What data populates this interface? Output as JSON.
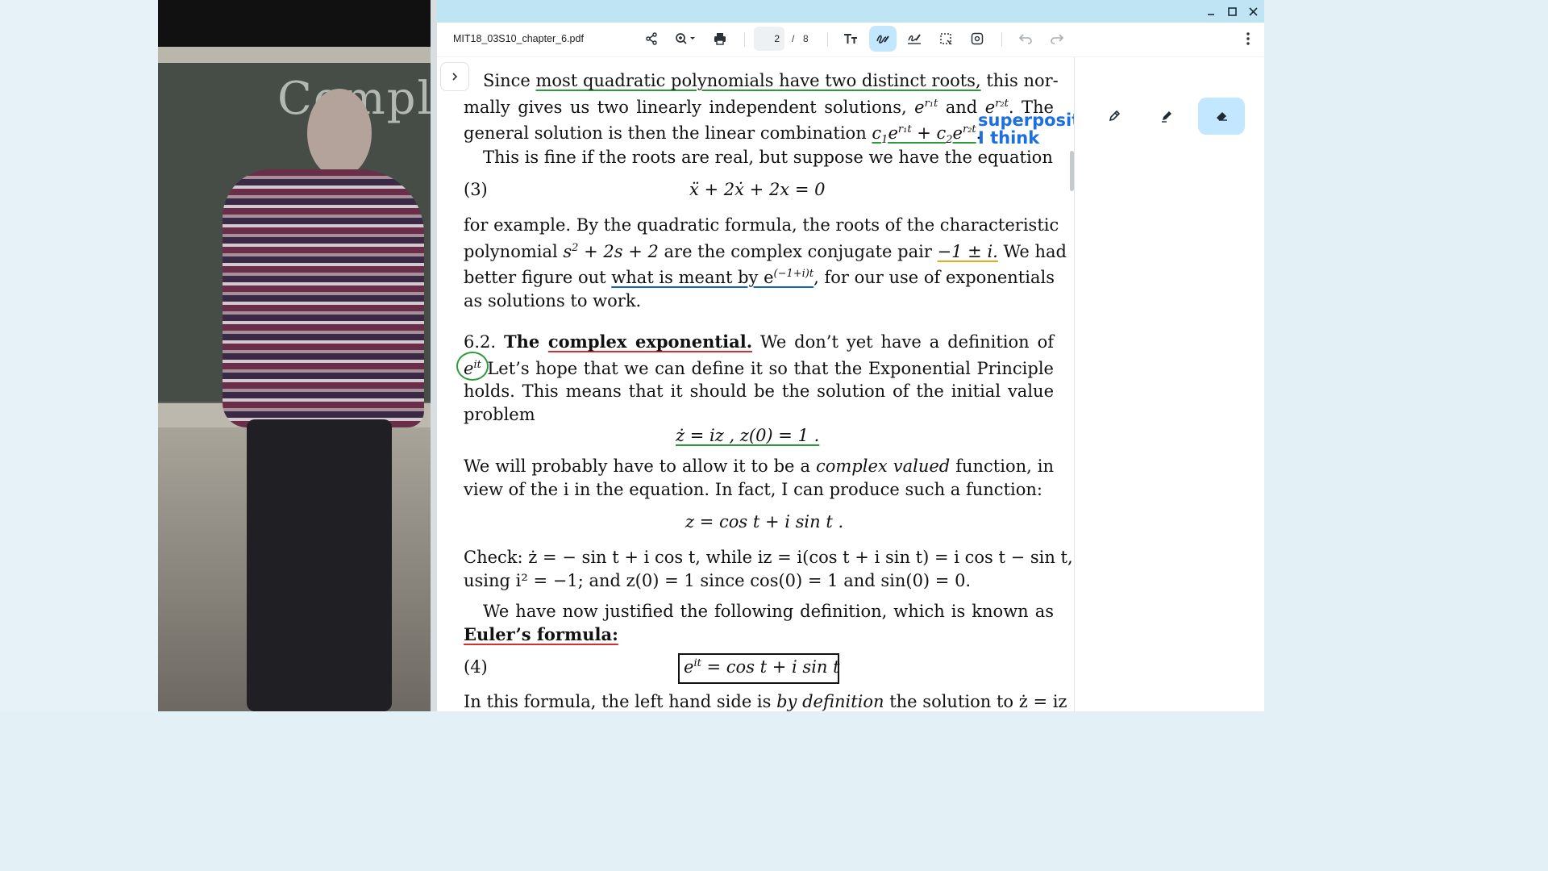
{
  "window": {
    "filename": "MIT18_03S10_chapter_6.pdf",
    "current_page": "2",
    "page_separator": "/",
    "total_pages": "8"
  },
  "video": {
    "board_text": "Complex"
  },
  "document": {
    "p1_lines": [
      "Since most quadratic polynomials have two distinct roots, this nor-",
      "mally gives us two linearly independent solutions, e^{r1t} and e^{r2t}. The",
      "general solution is then the linear combination c1e^{r1t} + c2e^{r2t}."
    ],
    "p1_l1_a": "Since ",
    "p1_l1_ul": "most quadratic polynomials have two distinct roots,",
    "p1_l1_b": " this nor-",
    "p1_l2_a": "mally gives us two linearly independent solutions, ",
    "p1_l2_b": " and ",
    "p1_l2_c": ".  The",
    "p1_l3_a": "general solution is then the linear combination ",
    "note": [
      "superposition",
      "I think"
    ],
    "p2": "This is fine if the roots are real, but suppose we have the equation",
    "eq3_num": "(3)",
    "eq3": "ẍ + 2ẋ + 2x = 0",
    "p3_l1": "for example.  By the quadratic formula, the roots of the characteristic",
    "p3_l2_a": "polynomial ",
    "p3_l2_b": " are the complex conjugate pair ",
    "p3_l2_pair": "−1 ± i.",
    "p3_l2_c": " We had",
    "p3_l3_a": "better figure out ",
    "p3_l3_ul": "what is meant by e",
    "p3_l3_b": ", for our use of exponentials",
    "p3_l4": "as solutions to work.",
    "sec_num": "6.2.",
    "sec_title_a": "The ",
    "sec_title_ul": "complex exponential.",
    "sec_l1_b": " We don’t yet have a definition of",
    "sec_l2": " Let’s hope that we can define it so that the Exponential Principle",
    "sec_l3": "holds.  This means that it should be the solution of the initial value",
    "sec_l4": "problem",
    "ivp": "ż = iz ,    z(0) = 1 .",
    "p4_l1_a": "We will probably have to allow it to be a ",
    "p4_l1_em": "complex valued",
    "p4_l1_b": " function, in",
    "p4_l2": "view of the i in the equation.  In fact, I can produce such a function:",
    "eq_z": "z = cos t + i sin t .",
    "check_l1": "Check:  ż = − sin t + i cos t, while iz = i(cos t + i sin t) = i cos t − sin t,",
    "check_l2": "using i² = −1; and z(0) = 1 since cos(0) = 1 and sin(0) = 0.",
    "p5_l1": "We have now justified the following definition, which is known as",
    "p5_l2": "Euler’s formula:",
    "eq4_num": "(4)",
    "eq4": "= cos t + i sin t",
    "last_a": "In this formula, the left hand side is ",
    "last_em": "by definition",
    "last_b": " the solution to ż = iz"
  },
  "colors": {
    "accent_active": "#c2e7ff",
    "titlebar": "#bfe5f5",
    "ink_green": "#2e9b3a",
    "ink_blue": "#1565c0",
    "ink_red": "#d32f2f",
    "ink_orange": "#f2a41c",
    "note_blue": "#1c6fe0"
  },
  "icons": {
    "toolbar": [
      "share-icon",
      "zoom-icon",
      "print-icon",
      "text-icon",
      "draw-icon",
      "signature-icon",
      "select-icon",
      "lens-icon",
      "undo-icon",
      "redo-icon",
      "more-icon"
    ],
    "pens": [
      "pen-icon",
      "highlighter-icon",
      "eraser-icon"
    ]
  }
}
